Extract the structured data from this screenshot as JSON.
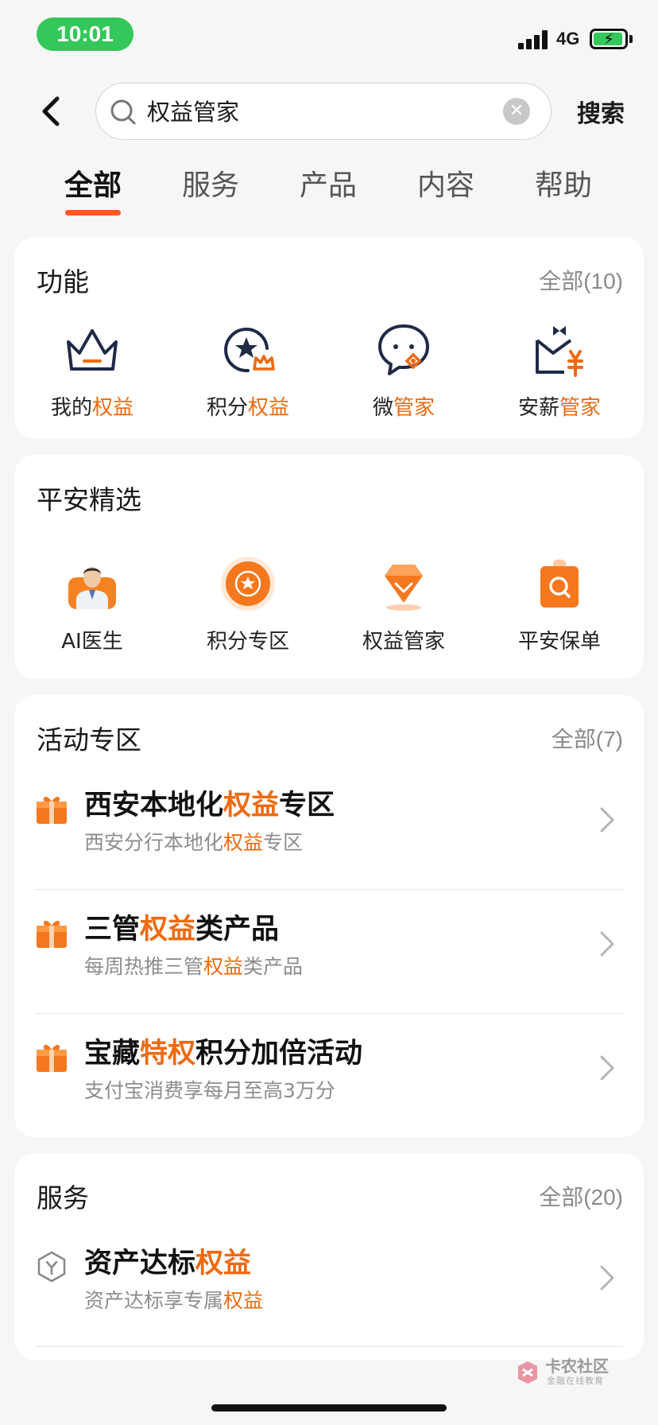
{
  "status_bar": {
    "time": "10:01",
    "network": "4G"
  },
  "search": {
    "query": "权益管家",
    "submit_label": "搜索"
  },
  "tabs": [
    {
      "label": "全部",
      "active": true
    },
    {
      "label": "服务",
      "active": false
    },
    {
      "label": "产品",
      "active": false
    },
    {
      "label": "内容",
      "active": false
    },
    {
      "label": "帮助",
      "active": false
    }
  ],
  "functions": {
    "title": "功能",
    "more_label": "全部(10)",
    "items": [
      {
        "pre": "我的",
        "hl": "权益",
        "icon": "crown-icon"
      },
      {
        "pre": "积分",
        "hl": "权益",
        "icon": "points-star-icon"
      },
      {
        "pre": "微",
        "hl": "管家",
        "icon": "chat-bubble-icon"
      },
      {
        "pre": "安薪",
        "hl": "管家",
        "icon": "salary-envelope-icon"
      }
    ]
  },
  "selection": {
    "title": "平安精选",
    "items": [
      {
        "label": "AI医生",
        "icon": "doctor-avatar-icon"
      },
      {
        "label": "积分专区",
        "icon": "points-badge-icon"
      },
      {
        "label": "权益管家",
        "icon": "diamond-icon"
      },
      {
        "label": "平安保单",
        "icon": "policy-bag-icon"
      }
    ]
  },
  "activities": {
    "title": "活动专区",
    "more_label": "全部(7)",
    "items": [
      {
        "title": [
          [
            "西安本地化",
            false
          ],
          [
            "权益",
            true
          ],
          [
            "专区",
            false
          ]
        ],
        "sub": [
          [
            "西安分行本地化",
            false
          ],
          [
            "权益",
            true
          ],
          [
            "专区",
            false
          ]
        ],
        "icon": "gift-icon"
      },
      {
        "title": [
          [
            "三管",
            false
          ],
          [
            "权益",
            true
          ],
          [
            "类产品",
            false
          ]
        ],
        "sub": [
          [
            "每周热推三管",
            false
          ],
          [
            "权益",
            true
          ],
          [
            "类产品",
            false
          ]
        ],
        "icon": "gift-icon"
      },
      {
        "title": [
          [
            "宝藏",
            false
          ],
          [
            "特权",
            true
          ],
          [
            "积分加倍活动",
            false
          ]
        ],
        "sub": [
          [
            "支付宝消费享每月至高3万分",
            false
          ]
        ],
        "icon": "gift-icon"
      }
    ]
  },
  "services": {
    "title": "服务",
    "more_label": "全部(20)",
    "items": [
      {
        "title": [
          [
            "资产达标",
            false
          ],
          [
            "权益",
            true
          ]
        ],
        "sub": [
          [
            "资产达标享专属",
            false
          ],
          [
            "权益",
            true
          ]
        ],
        "icon": "hexagon-yuan-icon"
      }
    ]
  },
  "watermark": {
    "title": "卡农社区",
    "sub": "金融在线教育"
  },
  "colors": {
    "accent": "#ef6a0f",
    "tab_underline": "#ff5a1e",
    "status_green": "#34c759"
  }
}
